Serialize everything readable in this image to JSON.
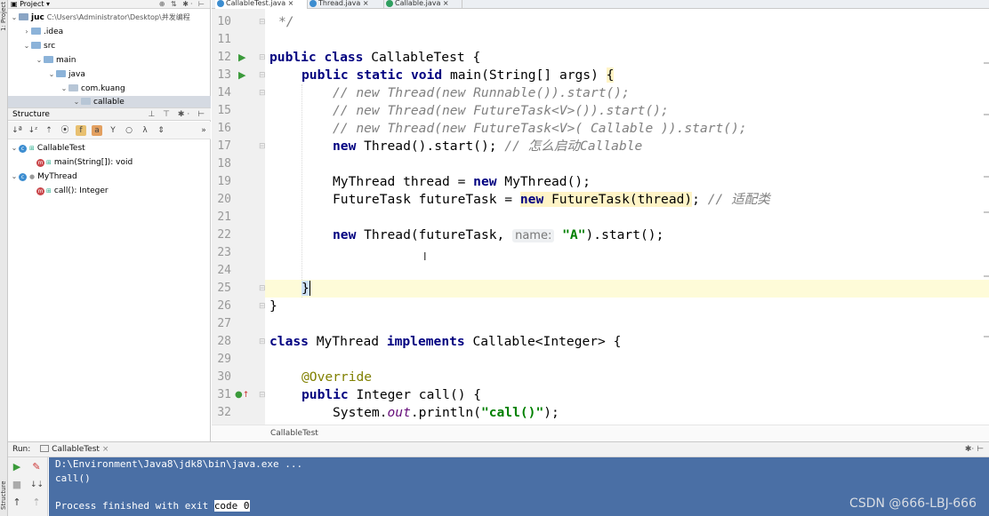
{
  "sidebar_stripe": {
    "project_label": "1: Project",
    "structure_label": "Structure"
  },
  "project": {
    "header_label": "Project",
    "tree": [
      {
        "label": "juc",
        "path": "C:\\Users\\Administrator\\Desktop\\并发编程"
      },
      {
        "label": ".idea"
      },
      {
        "label": "src"
      },
      {
        "label": "main"
      },
      {
        "label": "java"
      },
      {
        "label": "com.kuang"
      },
      {
        "label": "callable"
      }
    ]
  },
  "structure": {
    "header_label": "Structure",
    "items": [
      {
        "label": "CallableTest"
      },
      {
        "label": "main(String[]): void"
      },
      {
        "label": "MyThread"
      },
      {
        "label": "call(): Integer"
      }
    ]
  },
  "tabs": [
    {
      "label": "CallableTest.java",
      "active": true
    },
    {
      "label": "Thread.java",
      "active": false
    },
    {
      "label": "Callable.java",
      "active": false
    }
  ],
  "editor": {
    "line_numbers": [
      "10",
      "11",
      "12",
      "13",
      "14",
      "15",
      "16",
      "17",
      "18",
      "19",
      "20",
      "21",
      "22",
      "23",
      "24",
      "25",
      "26",
      "27",
      "28",
      "29",
      "30",
      "31",
      "32"
    ],
    "code": {
      "l10": "*/",
      "l12_kw1": "public class",
      "l12_rest": " CallableTest {",
      "l13_kw1": "public static void",
      "l13_rest": " main(String[] args) ",
      "l13_brace": "{",
      "l14": "// new Thread(new Runnable()).start();",
      "l15": "// new Thread(new FutureTask<V>()).start();",
      "l16": "// new Thread(new FutureTask<V>( Callable )).start();",
      "l17_kw": "new",
      "l17_rest": " Thread().start(); ",
      "l17_cm": "// 怎么启动Callable",
      "l19_a": "MyThread thread = ",
      "l19_kw": "new",
      "l19_b": " MyThread();",
      "l20_a": "FutureTask futureTask = ",
      "l20_kw": "new",
      "l20_b": " FutureTask(thread)",
      "l20_c": "; ",
      "l20_cm": "// 适配类",
      "l22_kw": "new",
      "l22_a": " Thread(futureTask,",
      "l22_hint": "name:",
      "l22_str": "\"A\"",
      "l22_b": ").start();",
      "l25": "}",
      "l26": "}",
      "l28_kw1": "class",
      "l28_a": " MyThread ",
      "l28_kw2": "implements",
      "l28_b": " Callable<Integer> {",
      "l30": "@Override",
      "l31_kw": "public",
      "l31_a": " Integer call() {",
      "l32_a": "System.",
      "l32_field": "out",
      "l32_b": ".println(",
      "l32_str": "\"call()\"",
      "l32_c": ");"
    },
    "breadcrumb": "CallableTest"
  },
  "run": {
    "label": "Run:",
    "config": "CallableTest",
    "console": {
      "line1": "D:\\Environment\\Java8\\jdk8\\bin\\java.exe ...",
      "line2": "call()",
      "line4_a": "Process finished with exit ",
      "line4_b": "code 0"
    }
  },
  "watermark": "CSDN @666-LBJ-666",
  "colors": {
    "keyword": "#000080",
    "comment": "#808080",
    "string": "#008000",
    "annotation": "#808000",
    "console_bg": "#4a6fa5",
    "current_line": "#fefbd8"
  }
}
